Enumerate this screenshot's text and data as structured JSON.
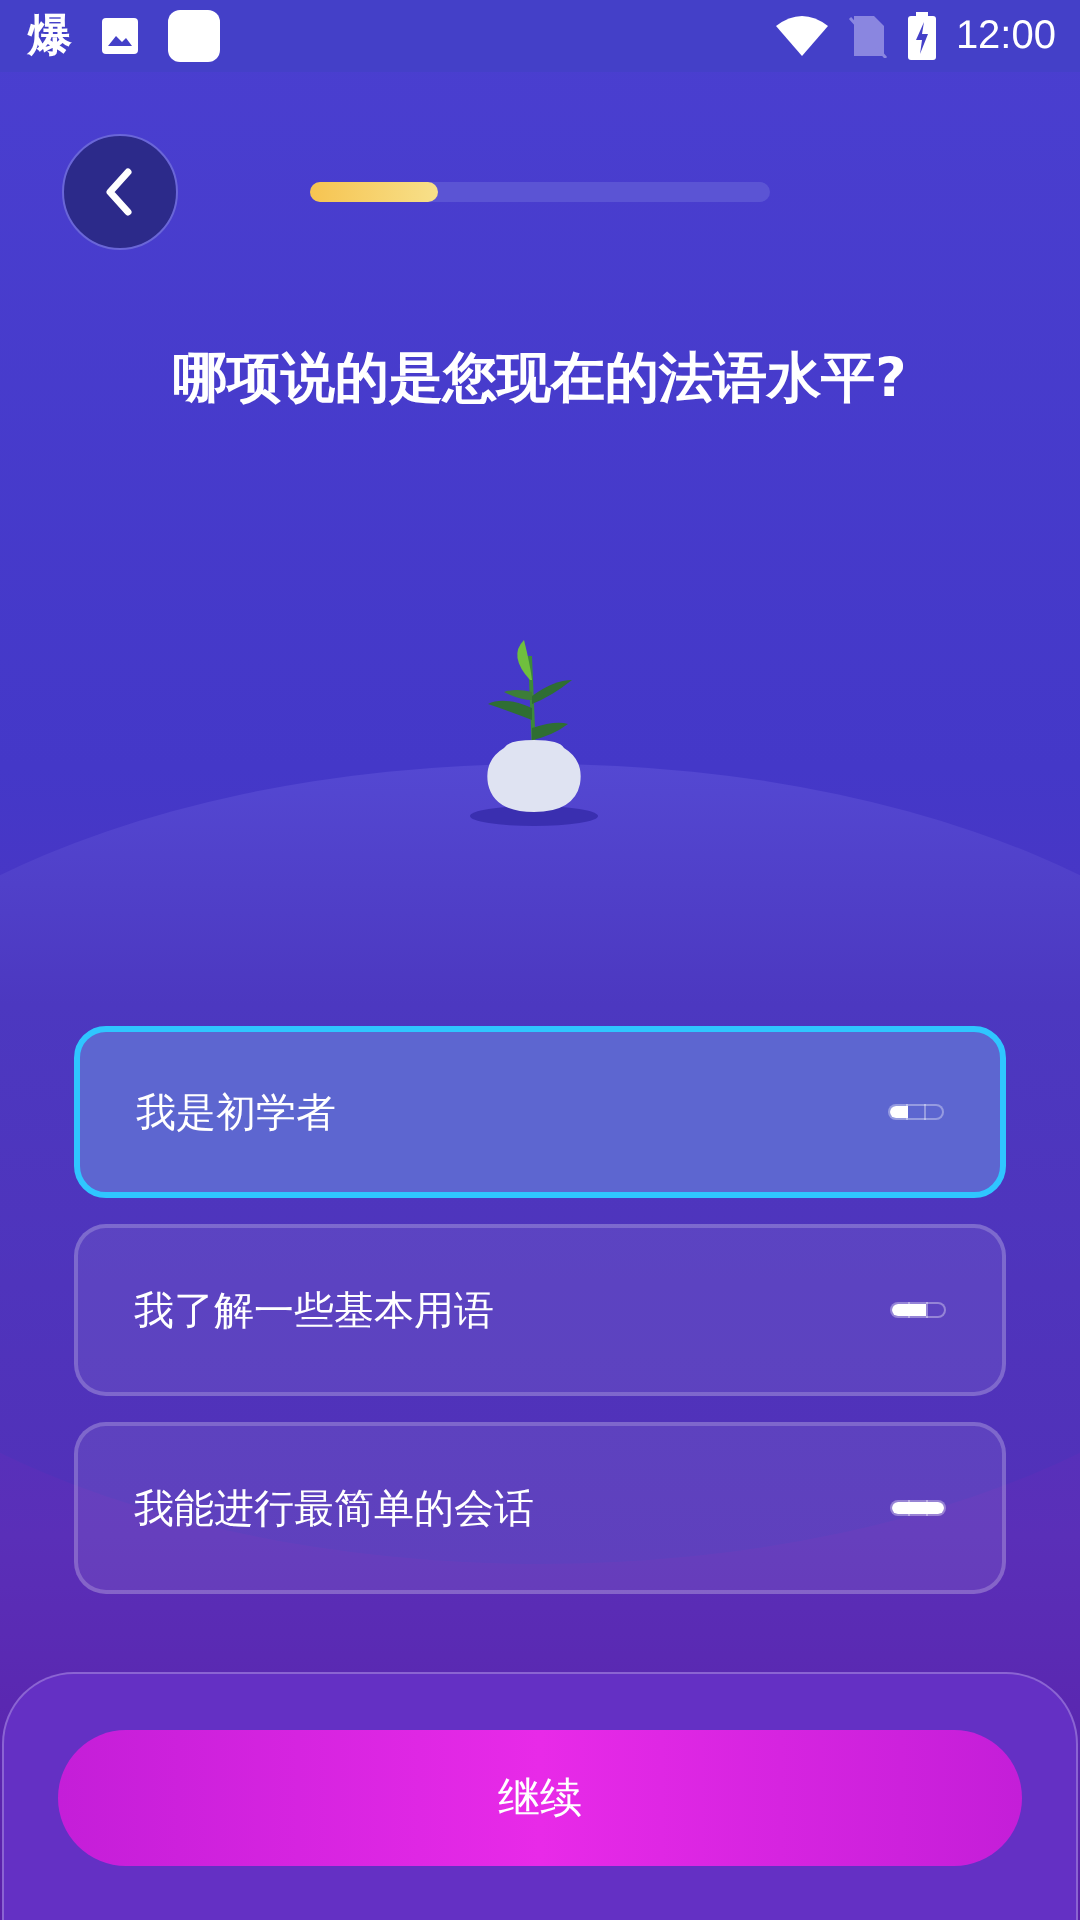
{
  "status_bar": {
    "app_glyph": "爆",
    "time": "12:00"
  },
  "progress": {
    "level": 0.28
  },
  "question": "哪项说的是您现在的法语水平?",
  "options": [
    {
      "label": "我是初学者",
      "selected": true,
      "level": 0.33
    },
    {
      "label": "我了解一些基本用语",
      "selected": false,
      "level": 0.67
    },
    {
      "label": "我能进行最简单的会话",
      "selected": false,
      "level": 1
    }
  ],
  "continue_button": "继续"
}
